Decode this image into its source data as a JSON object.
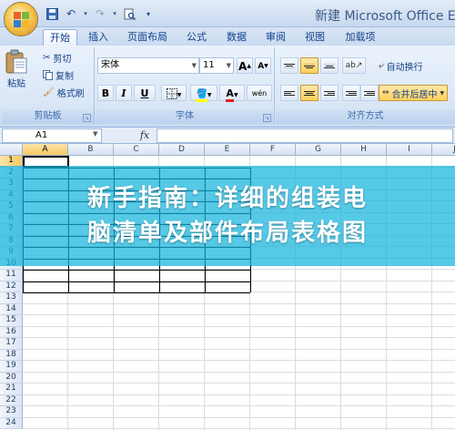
{
  "window": {
    "title": "新建 Microsoft Office E"
  },
  "tabs": [
    {
      "label": "开始",
      "active": true
    },
    {
      "label": "插入"
    },
    {
      "label": "页面布局"
    },
    {
      "label": "公式"
    },
    {
      "label": "数据"
    },
    {
      "label": "审阅"
    },
    {
      "label": "视图"
    },
    {
      "label": "加载项"
    }
  ],
  "ribbon": {
    "clipboard": {
      "label": "剪贴板",
      "paste": "粘贴",
      "cut": "剪切",
      "copy": "复制",
      "format_painter": "格式刷"
    },
    "font": {
      "label": "字体",
      "family": "宋体",
      "size": "11",
      "bold": "B",
      "italic": "I",
      "underline": "U",
      "grow": "A",
      "shrink": "A",
      "font_color": "A",
      "phonetic": "wén"
    },
    "alignment": {
      "label": "对齐方式",
      "wrap_text": "自动换行",
      "merge_center": "合并后居中"
    }
  },
  "formula_bar": {
    "name_box": "A1",
    "fx": "fx",
    "content": ""
  },
  "sheet": {
    "columns": [
      "A",
      "B",
      "C",
      "D",
      "E",
      "F",
      "G",
      "H",
      "I",
      "J"
    ],
    "rows": [
      "1",
      "2",
      "3",
      "4",
      "5",
      "6",
      "7",
      "8",
      "9",
      "10",
      "11",
      "12",
      "13",
      "14",
      "15",
      "16",
      "17",
      "18",
      "19",
      "20",
      "21",
      "22",
      "23",
      "24"
    ],
    "selected_cell": "A1"
  },
  "overlay": {
    "line1": "新手指南：详细的组装电",
    "line2": "脑清单及部件布局表格图"
  },
  "colors": {
    "accent": "#15428b",
    "banner": "#14b4dc",
    "selected_header": "#f8c961"
  }
}
